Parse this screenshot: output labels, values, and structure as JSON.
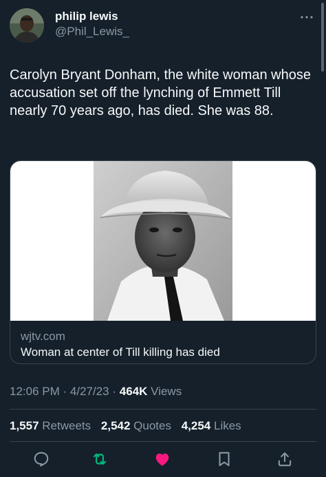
{
  "author": {
    "display_name": "philip lewis",
    "handle": "@Phil_Lewis_"
  },
  "tweet": {
    "text": "Carolyn Bryant Donham, the white woman whose accusation set off the lynching of Emmett Till nearly 70 years ago, has died. She was 88."
  },
  "link_card": {
    "domain": "wjtv.com",
    "title": "Woman at center of Till killing has died"
  },
  "meta": {
    "time": "12:06 PM",
    "separator": "·",
    "date": "4/27/23",
    "views_count": "464K",
    "views_label": "Views"
  },
  "stats": {
    "retweets_count": "1,557",
    "retweets_label": "Retweets",
    "quotes_count": "2,542",
    "quotes_label": "Quotes",
    "likes_count": "4,254",
    "likes_label": "Likes"
  },
  "actions": {
    "icons": [
      "reply-icon",
      "retweet-icon",
      "like-icon",
      "bookmark-icon",
      "share-icon"
    ]
  },
  "colors": {
    "background": "#15202b",
    "text": "#f7f9f9",
    "secondary_text": "#8b98a5",
    "border": "#38444d",
    "retweet_green": "#00ba7c",
    "like_pink": "#f91880"
  }
}
